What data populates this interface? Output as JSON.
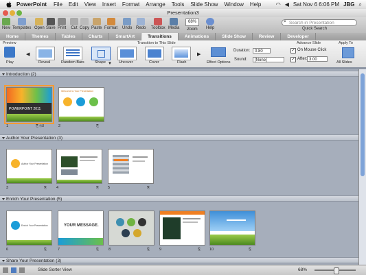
{
  "menubar": {
    "app": "PowerPoint",
    "items": [
      "File",
      "Edit",
      "View",
      "Insert",
      "Format",
      "Arrange",
      "Tools",
      "Slide Show",
      "Window",
      "Help"
    ],
    "datetime": "Sat Nov 6  6:06 PM",
    "user": "JBG"
  },
  "window": {
    "title": "Presentation3"
  },
  "toolbar": {
    "buttons": [
      "New",
      "Templates",
      "Open",
      "Save",
      "Print",
      "Cut",
      "Copy",
      "Paste",
      "Format",
      "Undo",
      "Redo",
      "Toolbox",
      "Media",
      "Zoom",
      "Help"
    ],
    "zoom_value": "68%",
    "search_placeholder": "Search in Presentation",
    "quick_search": "Quick Search"
  },
  "ribbon_tabs": [
    "Home",
    "Themes",
    "Tables",
    "Charts",
    "SmartArt",
    "Transitions",
    "Animations",
    "Slide Show",
    "Review",
    "Developer"
  ],
  "active_tab": "Transitions",
  "ribbon": {
    "preview_group": "Preview",
    "play_label": "Play",
    "transition_group": "Transition to This Slide",
    "transitions": [
      "Reveal",
      "Random Bars",
      "Shape",
      "Uncover",
      "Cover",
      "Flash"
    ],
    "effect_options": "Effect Options",
    "duration_label": "Duration:",
    "duration_value": "0.80",
    "sound_label": "Sound:",
    "sound_value": "[None]",
    "advance_group": "Advance Slide",
    "on_mouse_click": "On Mouse Click",
    "after_label": "After:",
    "after_value": "3.00",
    "apply_group": "Apply To",
    "all_slides": "All Slides"
  },
  "sections": [
    {
      "title": "Introduction (2)"
    },
    {
      "title": "Author Your Presentation (3)"
    },
    {
      "title": "Enrich Your Presentation (5)"
    },
    {
      "title": "Share Your Presentation (3)"
    }
  ],
  "slides": {
    "s1_title": "POWERPOINT 2011",
    "s2_title": "Welcome to Your Presentation",
    "s3_title": "Author Your Presentation",
    "s7_title": "YOUR MESSAGE.",
    "s6_title": "Enrich Your Presentation"
  },
  "slide_numbers": [
    "1",
    "2",
    "3",
    "4",
    "5",
    "6",
    "7",
    "8",
    "9",
    "10"
  ],
  "status": {
    "view": "Slide Sorter View",
    "zoom": "68%"
  }
}
